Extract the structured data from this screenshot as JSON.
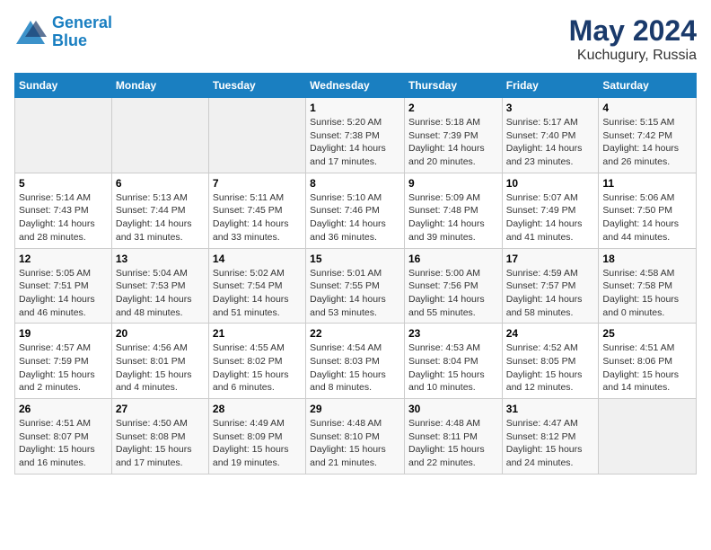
{
  "logo": {
    "line1": "General",
    "line2": "Blue"
  },
  "title": {
    "month_year": "May 2024",
    "location": "Kuchugury, Russia"
  },
  "headers": [
    "Sunday",
    "Monday",
    "Tuesday",
    "Wednesday",
    "Thursday",
    "Friday",
    "Saturday"
  ],
  "weeks": [
    [
      {
        "day": "",
        "info": ""
      },
      {
        "day": "",
        "info": ""
      },
      {
        "day": "",
        "info": ""
      },
      {
        "day": "1",
        "info": "Sunrise: 5:20 AM\nSunset: 7:38 PM\nDaylight: 14 hours\nand 17 minutes."
      },
      {
        "day": "2",
        "info": "Sunrise: 5:18 AM\nSunset: 7:39 PM\nDaylight: 14 hours\nand 20 minutes."
      },
      {
        "day": "3",
        "info": "Sunrise: 5:17 AM\nSunset: 7:40 PM\nDaylight: 14 hours\nand 23 minutes."
      },
      {
        "day": "4",
        "info": "Sunrise: 5:15 AM\nSunset: 7:42 PM\nDaylight: 14 hours\nand 26 minutes."
      }
    ],
    [
      {
        "day": "5",
        "info": "Sunrise: 5:14 AM\nSunset: 7:43 PM\nDaylight: 14 hours\nand 28 minutes."
      },
      {
        "day": "6",
        "info": "Sunrise: 5:13 AM\nSunset: 7:44 PM\nDaylight: 14 hours\nand 31 minutes."
      },
      {
        "day": "7",
        "info": "Sunrise: 5:11 AM\nSunset: 7:45 PM\nDaylight: 14 hours\nand 33 minutes."
      },
      {
        "day": "8",
        "info": "Sunrise: 5:10 AM\nSunset: 7:46 PM\nDaylight: 14 hours\nand 36 minutes."
      },
      {
        "day": "9",
        "info": "Sunrise: 5:09 AM\nSunset: 7:48 PM\nDaylight: 14 hours\nand 39 minutes."
      },
      {
        "day": "10",
        "info": "Sunrise: 5:07 AM\nSunset: 7:49 PM\nDaylight: 14 hours\nand 41 minutes."
      },
      {
        "day": "11",
        "info": "Sunrise: 5:06 AM\nSunset: 7:50 PM\nDaylight: 14 hours\nand 44 minutes."
      }
    ],
    [
      {
        "day": "12",
        "info": "Sunrise: 5:05 AM\nSunset: 7:51 PM\nDaylight: 14 hours\nand 46 minutes."
      },
      {
        "day": "13",
        "info": "Sunrise: 5:04 AM\nSunset: 7:53 PM\nDaylight: 14 hours\nand 48 minutes."
      },
      {
        "day": "14",
        "info": "Sunrise: 5:02 AM\nSunset: 7:54 PM\nDaylight: 14 hours\nand 51 minutes."
      },
      {
        "day": "15",
        "info": "Sunrise: 5:01 AM\nSunset: 7:55 PM\nDaylight: 14 hours\nand 53 minutes."
      },
      {
        "day": "16",
        "info": "Sunrise: 5:00 AM\nSunset: 7:56 PM\nDaylight: 14 hours\nand 55 minutes."
      },
      {
        "day": "17",
        "info": "Sunrise: 4:59 AM\nSunset: 7:57 PM\nDaylight: 14 hours\nand 58 minutes."
      },
      {
        "day": "18",
        "info": "Sunrise: 4:58 AM\nSunset: 7:58 PM\nDaylight: 15 hours\nand 0 minutes."
      }
    ],
    [
      {
        "day": "19",
        "info": "Sunrise: 4:57 AM\nSunset: 7:59 PM\nDaylight: 15 hours\nand 2 minutes."
      },
      {
        "day": "20",
        "info": "Sunrise: 4:56 AM\nSunset: 8:01 PM\nDaylight: 15 hours\nand 4 minutes."
      },
      {
        "day": "21",
        "info": "Sunrise: 4:55 AM\nSunset: 8:02 PM\nDaylight: 15 hours\nand 6 minutes."
      },
      {
        "day": "22",
        "info": "Sunrise: 4:54 AM\nSunset: 8:03 PM\nDaylight: 15 hours\nand 8 minutes."
      },
      {
        "day": "23",
        "info": "Sunrise: 4:53 AM\nSunset: 8:04 PM\nDaylight: 15 hours\nand 10 minutes."
      },
      {
        "day": "24",
        "info": "Sunrise: 4:52 AM\nSunset: 8:05 PM\nDaylight: 15 hours\nand 12 minutes."
      },
      {
        "day": "25",
        "info": "Sunrise: 4:51 AM\nSunset: 8:06 PM\nDaylight: 15 hours\nand 14 minutes."
      }
    ],
    [
      {
        "day": "26",
        "info": "Sunrise: 4:51 AM\nSunset: 8:07 PM\nDaylight: 15 hours\nand 16 minutes."
      },
      {
        "day": "27",
        "info": "Sunrise: 4:50 AM\nSunset: 8:08 PM\nDaylight: 15 hours\nand 17 minutes."
      },
      {
        "day": "28",
        "info": "Sunrise: 4:49 AM\nSunset: 8:09 PM\nDaylight: 15 hours\nand 19 minutes."
      },
      {
        "day": "29",
        "info": "Sunrise: 4:48 AM\nSunset: 8:10 PM\nDaylight: 15 hours\nand 21 minutes."
      },
      {
        "day": "30",
        "info": "Sunrise: 4:48 AM\nSunset: 8:11 PM\nDaylight: 15 hours\nand 22 minutes."
      },
      {
        "day": "31",
        "info": "Sunrise: 4:47 AM\nSunset: 8:12 PM\nDaylight: 15 hours\nand 24 minutes."
      },
      {
        "day": "",
        "info": ""
      }
    ]
  ]
}
